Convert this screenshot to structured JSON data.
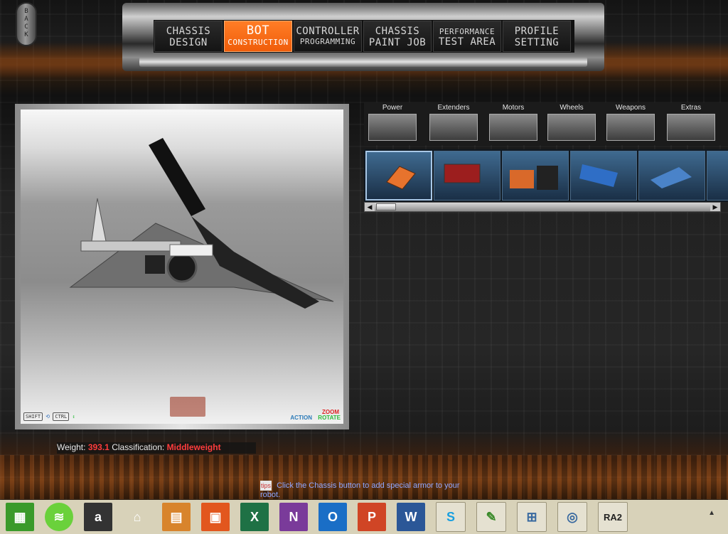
{
  "back_label": "BACK",
  "nav": {
    "tabs": [
      {
        "line1": "CHASSIS",
        "line2": "DESIGN"
      },
      {
        "line1": "BOT",
        "line2": "CONSTRUCTION",
        "active": true
      },
      {
        "line1": "CONTROLLER",
        "line2": "PROGRAMMING"
      },
      {
        "line1": "CHASSIS",
        "line2": "PAINT JOB"
      },
      {
        "line1": "PERFORMANCE",
        "line2": "TEST AREA"
      },
      {
        "line1": "PROFILE",
        "line2": "SETTING"
      }
    ]
  },
  "categories": [
    "Power",
    "Extenders",
    "Motors",
    "Wheels",
    "Weapons",
    "Extras"
  ],
  "viewport": {
    "shift_key": "SHIFT",
    "ctrl_key": "CTRL",
    "zoom": "ZOOM",
    "action": "ACTION",
    "rotate": "ROTATE"
  },
  "stats": {
    "weight_label": "Weight:",
    "weight_value": "393.1",
    "class_label": "Classification:",
    "class_value": "Middleweight"
  },
  "tip": {
    "icon": "tips",
    "text": "Click the Chassis button to add special armor to your robot."
  },
  "taskbar": {
    "apps": [
      "store-icon",
      "spotify-icon",
      "amazon-icon",
      "home-icon",
      "files-icon",
      "photos-icon",
      "excel-icon",
      "onenote-icon",
      "outlook-icon",
      "powerpoint-icon",
      "word-icon",
      "skype-icon",
      "notepad-icon",
      "network-icon",
      "cortana-icon",
      "ra2-icon"
    ],
    "ra2_label": "RA2",
    "tray_arrow": "▲"
  },
  "colors": {
    "accent": "#f05d0a",
    "stat_red": "#ff3c3c",
    "tip_blue": "#8fa7ff"
  }
}
